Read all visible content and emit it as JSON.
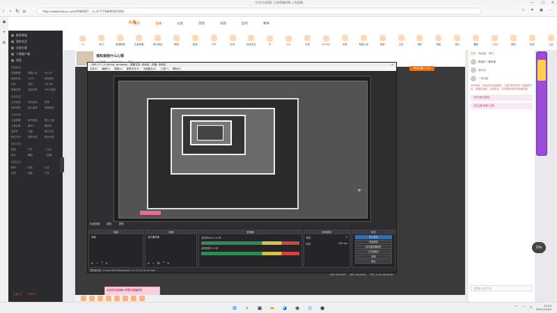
{
  "window": {
    "title": "【大护法直播】王者荣耀直播_斗鱼直播",
    "controls": [
      "—",
      "□",
      "✕"
    ]
  },
  "browser": {
    "url": "https://www.douyu.com/9568587... 1=9:77728695567859"
  },
  "site": {
    "logo": "斗鱼",
    "nav": [
      "首页",
      "直播",
      "分类",
      "游戏",
      "视频",
      "鱼吧",
      "赛事"
    ],
    "categories": [
      "12",
      "热门",
      "英雄联盟",
      "王者荣耀",
      "和平精英",
      "颜值",
      "星秀",
      "户外",
      "吃鸡",
      "绝地求生",
      "CF",
      "LOL",
      "手游",
      "DOTA2",
      "体育",
      "穿越火线",
      "网游",
      "主机",
      "单机",
      "明星",
      "音乐",
      "舞蹈",
      "二次元",
      "数码",
      "科技",
      "公益"
    ]
  },
  "sidebar": {
    "top_items": [
      "推荐频道",
      "我的关注",
      "全部分类",
      "下载客户端",
      "发现"
    ],
    "sections": [
      {
        "title": "网游竞技",
        "items": [
          "英雄联盟",
          "穿越火线",
          "DOTA2",
          "使命召唤",
          "CSGO",
          "绝地求生",
          "DNF",
          "逆战",
          "QQ飞车",
          "魔兽世界",
          "坦克世界",
          "APEX英雄"
        ]
      },
      {
        "title": "单机热游",
        "items": [
          "主机游戏",
          "怀旧游戏",
          "原神",
          "我的世界",
          "独立游戏",
          "恐怖游戏"
        ]
      },
      {
        "title": "手游休闲",
        "items": [
          "王者荣耀",
          "和平精英",
          "第五人格",
          "火影忍者",
          "崩坏3",
          "阴阳师",
          "金铲铲",
          "光遇",
          "蛋仔派对",
          "明日方舟",
          "原神手游",
          "更多手游"
        ]
      },
      {
        "title": "娱乐天地",
        "items": [
          "颜值",
          "户外",
          "二次元",
          "音乐",
          "舞蹈",
          "一起看"
        ]
      },
      {
        "title": "科技文化",
        "items": [
          "数码",
          "科技",
          "文化",
          "体育",
          "美食",
          "汽车"
        ]
      }
    ],
    "bottom": [
      "主播入驻",
      "下载APP"
    ]
  },
  "room": {
    "title": "谁知道我什么心情",
    "meta": [
      "王者荣耀",
      "9568587",
      "举报"
    ],
    "follow_label": "关注主播 1.2万"
  },
  "obs": {
    "title": "OBS 27.1.3 (64-bit, windows) - 配置文件: 未命名 - 场景: 未命名",
    "menu": [
      "文件(F)",
      "编辑(E)",
      "视图(V)",
      "配置文件(P)",
      "场景集合(S)",
      "工具(T)",
      "帮助(H)"
    ],
    "status_bar": [
      "未选择源",
      "属性",
      "滤镜"
    ],
    "docks": {
      "scenes": {
        "title": "场景",
        "items": [
          "场景"
        ]
      },
      "sources": {
        "title": "来源",
        "items": [
          "显示器采集"
        ]
      },
      "mixer": {
        "title": "混音器",
        "channels": [
          {
            "label": "麦克风/Aux",
            "value": "0.0 dB"
          },
          {
            "label": "桌面音频",
            "value": "0.0 dB"
          }
        ]
      },
      "transitions": {
        "title": "转场特效",
        "type": "渐变",
        "duration_label": "时长",
        "duration": "300 ms"
      },
      "controls": {
        "title": "控件",
        "buttons": [
          "停止推流",
          "开始录制",
          "启动虚拟摄像机",
          "工作室模式",
          "设置",
          "退出"
        ]
      }
    },
    "footer": "录制保存到: C:/Users/XOG/Videos/2021-11-22 22-43-42.mkv",
    "footer_stats": [
      "LIVE: 00:00:00",
      "REC: 00:00:00",
      "CPU: 3.4%, 60.00 fps"
    ],
    "danmaku": "弹"
  },
  "caption_text": "欢迎来到直播间,请遵守直播规范",
  "right_panel": {
    "tabs": [
      "贵宾",
      "粉丝团",
      "排行"
    ],
    "ranks": [
      "醉酒可一骨奇缘",
      "帅小伙",
      "一本万历"
    ],
    "chat": "系统消息：欢迎来到本直播间，斗鱼严禁未成年人直播或打赏，请理性消费，文明发言，共同营造良好的直播氛围。",
    "cards": [
      "今天开播 奖励送",
      "关注主播 领取小礼物"
    ],
    "timer": "15s",
    "input_placeholder": "这里输入聊天内容"
  },
  "taskbar": {
    "time": "22:43",
    "date": "2021/11/22"
  }
}
